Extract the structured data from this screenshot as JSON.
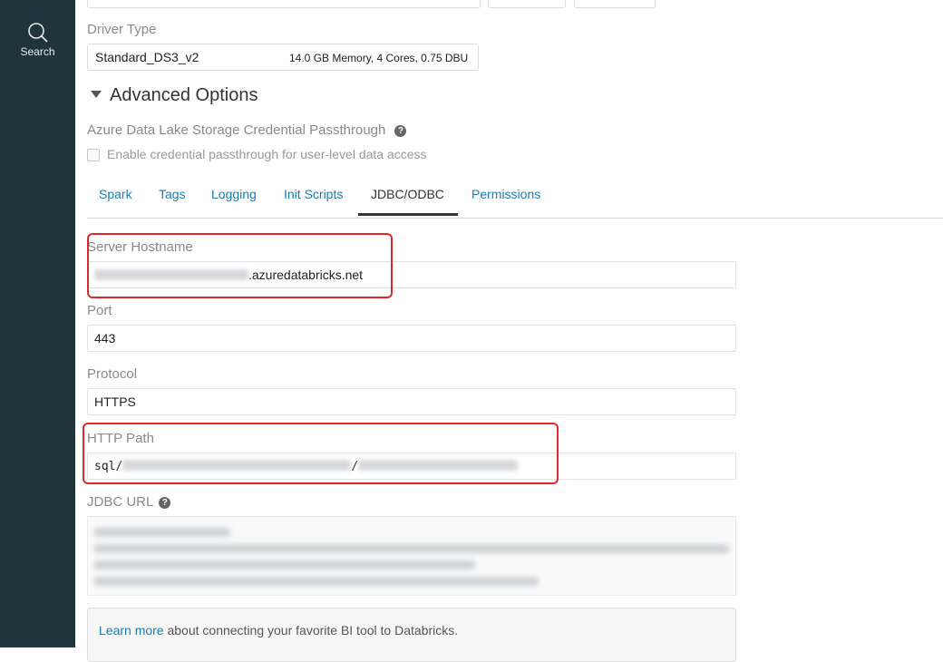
{
  "sidebar": {
    "search_label": "Search"
  },
  "driver": {
    "label": "Driver Type",
    "value": "Standard_DS3_v2",
    "specs": "14.0 GB Memory, 4 Cores, 0.75 DBU"
  },
  "advanced": {
    "title": "Advanced Options"
  },
  "passthrough": {
    "label": "Azure Data Lake Storage Credential Passthrough",
    "checkbox_label": "Enable credential passthrough for user-level data access"
  },
  "tabs": [
    {
      "label": "Spark"
    },
    {
      "label": "Tags"
    },
    {
      "label": "Logging"
    },
    {
      "label": "Init Scripts"
    },
    {
      "label": "JDBC/ODBC"
    },
    {
      "label": "Permissions"
    }
  ],
  "active_tab": "JDBC/ODBC",
  "fields": {
    "server_hostname": {
      "label": "Server Hostname",
      "value_suffix": ".azuredatabricks.net"
    },
    "port": {
      "label": "Port",
      "value": "443"
    },
    "protocol": {
      "label": "Protocol",
      "value": "HTTPS"
    },
    "http_path": {
      "label": "HTTP Path",
      "prefix": "sql/",
      "separator": "/"
    },
    "jdbc_url": {
      "label": "JDBC URL"
    }
  },
  "info": {
    "link_text": "Learn more",
    "text": " about connecting your favorite BI tool to Databricks."
  },
  "colors": {
    "sidebar_bg": "#1f343b",
    "link": "#1a7db8",
    "annotation": "#e02828"
  }
}
